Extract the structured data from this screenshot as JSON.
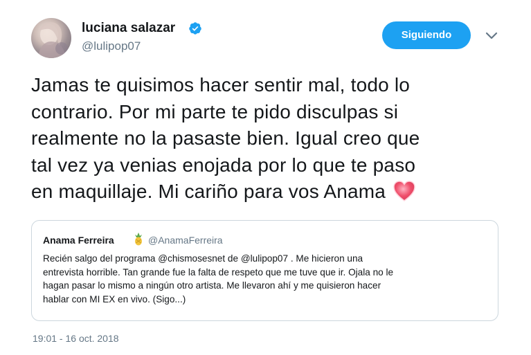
{
  "author": {
    "display_name": "luciana salazar",
    "handle": "@lulipop07",
    "verified_icon": "verified-badge-icon",
    "avatar_icon": "profile-photo"
  },
  "follow_button": {
    "label": "Siguiendo"
  },
  "menu_icon": "chevron-down-icon",
  "tweet": {
    "lines": [
      "Jamas te quisimos hacer sentir mal, todo lo",
      "contrario. Por mi parte te pido disculpas si",
      "realmente no la pasaste bien. Igual creo que",
      "tal vez ya venias enojada por lo que te paso",
      "en maquillaje. Mi cariño para vos Anama"
    ],
    "emoji": "sparkling-heart-icon"
  },
  "quoted_tweet": {
    "display_name": "Anama Ferreira",
    "emoji": "pineapple-icon",
    "handle": "@AnamaFerreira",
    "lines": [
      "Recién salgo del programa @chismosesnet de @lulipop07 . Me hicieron una",
      "entrevista horrible. Tan grande fue la falta de respeto que me tuve que ir. Ojala no le",
      "hagan pasar lo mismo a ningún otro artista. Me llevaron ahí y me quisieron hacer",
      "hablar con MI EX en vivo. (Sigo...)"
    ]
  },
  "timestamp": "19:01 - 16 oct. 2018",
  "colors": {
    "accent": "#1da1f2",
    "secondary_text": "#657786",
    "border": "#ccd6dd",
    "heart": "#ef4f6b"
  }
}
